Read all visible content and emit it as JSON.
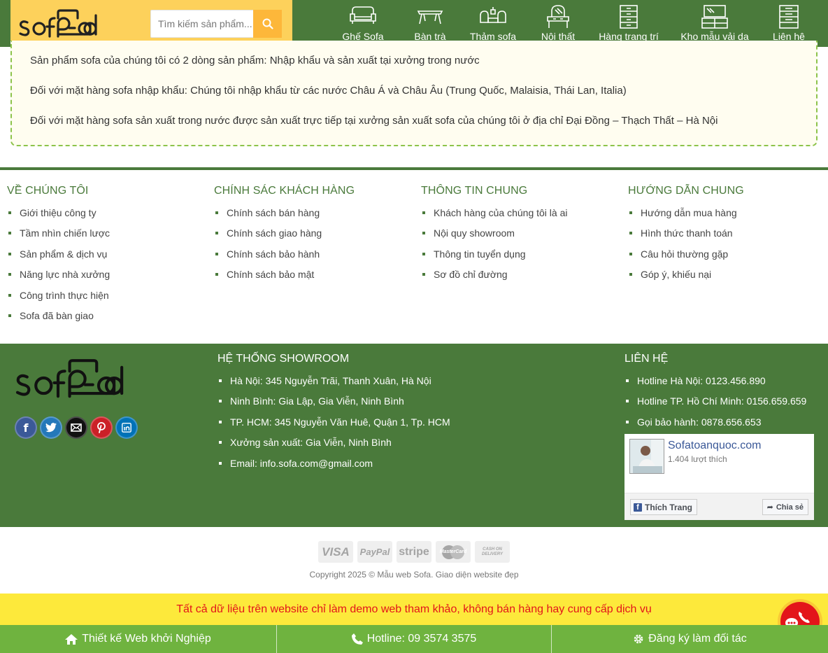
{
  "header": {
    "logo_text": "sofa-ab",
    "search": {
      "placeholder": "Tìm kiếm sản phẩm..."
    },
    "nav": [
      {
        "label": "Ghế Sofa",
        "icon": "sofa-icon"
      },
      {
        "label": "Bàn trà",
        "icon": "coffee-table-icon"
      },
      {
        "label": "Thảm sofa",
        "icon": "rug-icon"
      },
      {
        "label": "Nội thất",
        "icon": "dresser-mirror-icon"
      },
      {
        "label": "Hàng trang trí",
        "icon": "cabinet-icon"
      },
      {
        "label": "Kho mẫu vải da",
        "icon": "tv-stand-icon"
      },
      {
        "label": "Liên hệ",
        "icon": "drawer-icon"
      }
    ]
  },
  "intro": {
    "lines": [
      "Sản phẩm sofa của chúng tôi có 2 dòng sản phẩm: Nhập khẩu và sản xuất tại xưởng trong nước",
      "Đối với mặt hàng sofa nhập khẩu: Chúng tôi nhập khẩu từ các nước Châu Á và Châu Âu (Trung Quốc, Malaisia, Thái Lan, Italia)",
      "Đối với mặt hàng sofa sản xuất trong nước được sản xuất trực tiếp tại xưởng sản xuất sofa của chúng tôi ở địa chỉ Đại Đồng – Thạch Thất – Hà Nội"
    ]
  },
  "footer_links": [
    {
      "title": "VỀ CHÚNG TÔI",
      "items": [
        "Giới thiệu công ty",
        "Tầm nhìn chiến lược",
        "Sản phẩm & dịch vụ",
        "Năng lực nhà xưởng",
        "Công trình thực hiện",
        "Sofa đã bàn giao"
      ]
    },
    {
      "title": "CHÍNH SÁC KHÁCH HÀNG",
      "items": [
        "Chính sách bán hàng",
        "Chính sách giao hàng",
        "Chính sách bảo hành",
        "Chính sách bảo mật"
      ]
    },
    {
      "title": "THÔNG TIN CHUNG",
      "items": [
        "Khách hàng của chúng tôi là ai",
        "Nội quy showroom",
        "Thông tin tuyển dụng",
        "Sơ đồ chỉ đường"
      ]
    },
    {
      "title": "HƯỚNG DẪN CHUNG",
      "items": [
        "Hướng dẫn mua hàng",
        "Hình thức thanh toán",
        "Câu hỏi thường gặp",
        "Góp ý, khiếu nại"
      ]
    }
  ],
  "showroom": {
    "title": "HỆ THỐNG SHOWROOM",
    "items": [
      "Hà Nội: 345 Nguyễn Trãi, Thanh Xuân, Hà Nội",
      "Ninh Bình: Gia Lập, Gia Viễn, Ninh Bình",
      "TP. HCM: 345 Nguyễn Văn Huê, Quận 1, Tp. HCM",
      "Xưởng sản xuất: Gia Viễn, Ninh Bình",
      "Email: info.sofa.com@gmail.com"
    ]
  },
  "contact": {
    "title": "LIÊN HỆ",
    "items": [
      "Hotline Hà Nội: 0123.456.890",
      "Hotline TP. Hồ Chí Minh: 0156.659.659",
      "Gọi bảo hành: 0878.656.653"
    ]
  },
  "social": [
    {
      "icon": "facebook-icon",
      "color": "#3b5998"
    },
    {
      "icon": "twitter-icon",
      "color": "#2478ba"
    },
    {
      "icon": "email-icon",
      "color": "#111111"
    },
    {
      "icon": "pinterest-icon",
      "color": "#cb2027"
    },
    {
      "icon": "linkedin-icon",
      "color": "#0072b7"
    }
  ],
  "facebook_widget": {
    "page_name": "Sofatoanquoc.com",
    "likes": "1.404 lượt thích",
    "like_label": "Thích Trang",
    "share_label": "Chia sẻ"
  },
  "payments": [
    "VISA",
    "PayPal",
    "stripe",
    "MasterCard",
    "CASH ON DELIVERY"
  ],
  "copyright": "Copyright 2025 © Mẫu web Sofa. Giao diện website đẹp",
  "notice": "Tất cả dữ liệu trên website chỉ làm demo web tham khảo, không bán hàng hay cung cấp dịch vụ",
  "bottom_bar": [
    {
      "label": "Thiết kế Web khởi Nghiệp",
      "icon": "home-icon"
    },
    {
      "label": "Hotline: 09 3574 3575",
      "icon": "phone-icon"
    },
    {
      "label": "Đăng ký làm đối tác",
      "icon": "gear-icon"
    }
  ],
  "colors": {
    "primary_green": "#4a7a3b",
    "accent_yellow": "#fdd15b",
    "search_button": "#fdb73a",
    "notice_bg": "#fde93b",
    "notice_text": "#e3151a",
    "bottom_bar": "#6fb33f"
  }
}
